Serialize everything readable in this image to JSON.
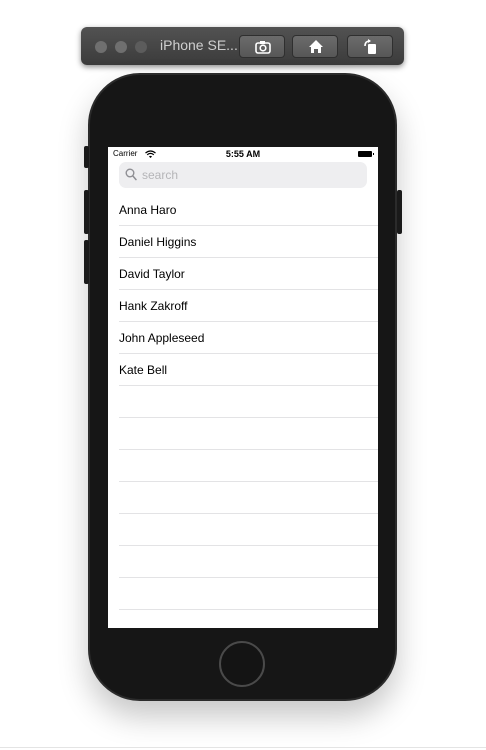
{
  "simulator": {
    "title": "iPhone SE...",
    "toolbar_buttons": [
      {
        "icon": "screenshot-icon"
      },
      {
        "icon": "home-icon"
      },
      {
        "icon": "rotate-icon"
      }
    ]
  },
  "status_bar": {
    "carrier": "Carrier",
    "time": "5:55 AM"
  },
  "search": {
    "placeholder": "search",
    "value": ""
  },
  "contacts": [
    {
      "name": "Anna Haro"
    },
    {
      "name": "Daniel Higgins"
    },
    {
      "name": "David Taylor"
    },
    {
      "name": "Hank Zakroff"
    },
    {
      "name": "John Appleseed"
    },
    {
      "name": "Kate Bell"
    }
  ]
}
